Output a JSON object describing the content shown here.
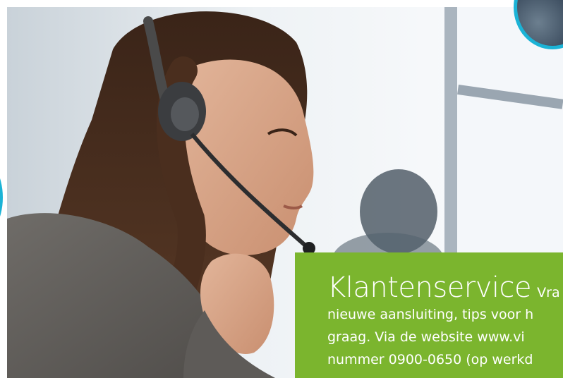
{
  "panel": {
    "heading": "Klantenservice",
    "lead": "Vra",
    "lines": [
      "nieuwe aansluiting, tips voor h",
      "graag. Via de website www.vi",
      "nummer 0900-0650 (op werkd"
    ]
  },
  "photo": {
    "subject": "customer-service-agent-with-headset"
  },
  "colors": {
    "panel_green": "#7bb52e",
    "ring_cyan": "#1bb3d6",
    "text": "#ffffff"
  }
}
